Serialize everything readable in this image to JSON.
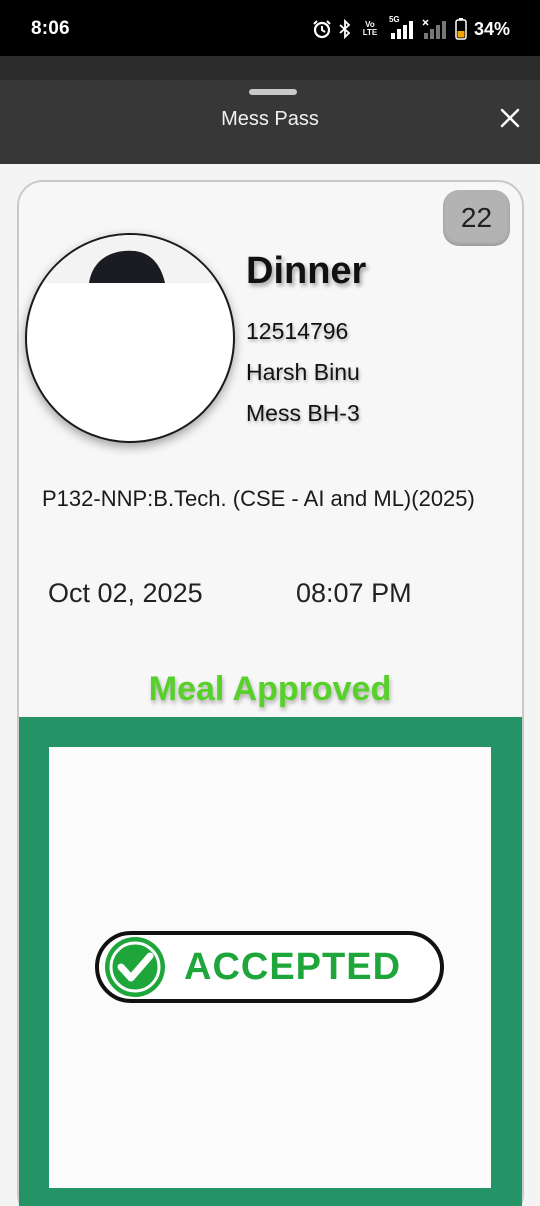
{
  "status_bar": {
    "time": "8:06",
    "volte_top": "Vo",
    "volte_bottom": "LTE",
    "net_label": "5G",
    "battery_percent": "34%",
    "icons": [
      "alarm-icon",
      "bluetooth-icon",
      "volte-icon",
      "signal-icon",
      "signal-icon",
      "battery-icon"
    ]
  },
  "sheet": {
    "title": "Mess Pass",
    "close_icon": "close-icon"
  },
  "pass": {
    "count_badge": "22",
    "meal": "Dinner",
    "registration_no": "12514796",
    "student_name": "Harsh Binu",
    "mess": "Mess BH-3",
    "program": "P132-NNP:B.Tech. (CSE - AI and ML)(2025)",
    "date": "Oct 02, 2025",
    "time": "08:07 PM",
    "status": "Meal Approved",
    "stamp_text": "ACCEPTED"
  },
  "colors": {
    "status_green": "#57d02a",
    "panel_green": "#249467",
    "stamp_green": "#1ea63a",
    "header_bg": "#373737"
  }
}
